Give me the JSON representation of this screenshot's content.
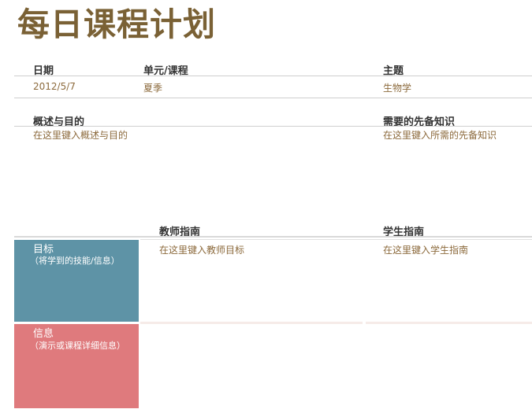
{
  "title": "每日课程计划",
  "details": {
    "date_label": "日期",
    "unit_label": "单元/课程",
    "topic_label": "主题",
    "date_value": "2012/5/7",
    "unit_value": "夏季",
    "topic_value": "生物学"
  },
  "overview": {
    "label": "概述与目的",
    "placeholder": "在这里键入概述与目的"
  },
  "prerequisites": {
    "label": "需要的先备知识",
    "placeholder": "在这里键入所需的先备知识"
  },
  "guide_headers": {
    "teacher": "教师指南",
    "student": "学生指南"
  },
  "rows": [
    {
      "label": "目标",
      "sublabel": "（将学到的技能/信息）",
      "color": "#5e93a6",
      "teacher_text": "在这里键入教师目标",
      "student_text": "在这里键入学生指南"
    },
    {
      "label": "信息",
      "sublabel": "（演示或课程详细信息）",
      "color": "#df7a7d",
      "teacher_text": "",
      "student_text": ""
    }
  ],
  "colors": {
    "title": "#7a6135",
    "value_text": "#8c6a3c",
    "accent_blue": "#5e93a6",
    "accent_pink": "#df7a7d"
  }
}
